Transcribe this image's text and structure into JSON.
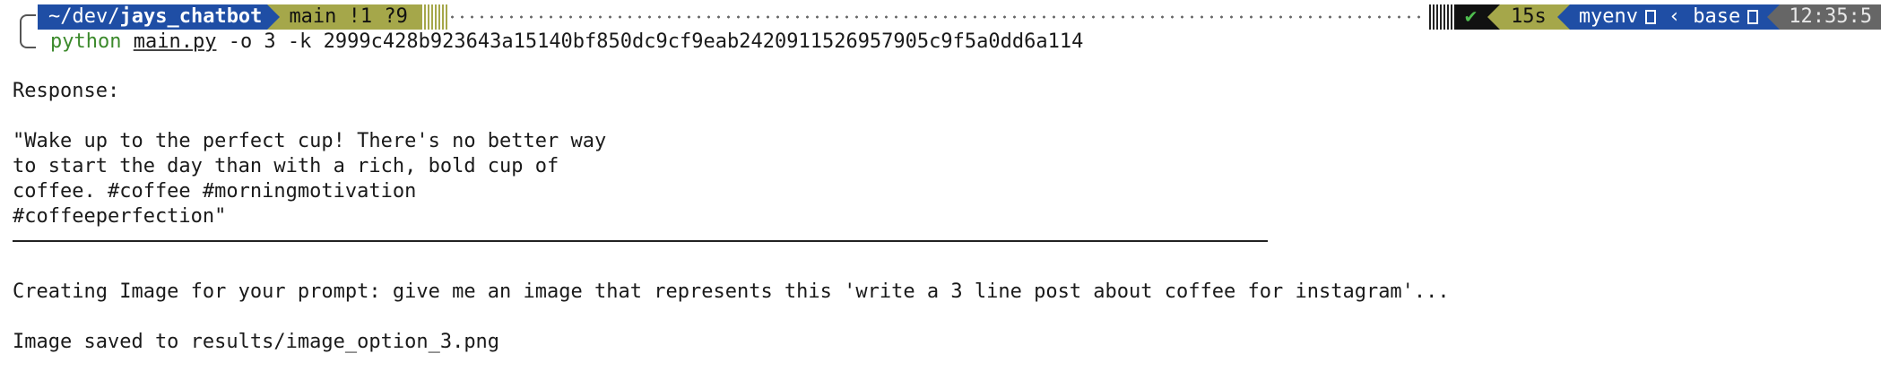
{
  "prompt": {
    "path_prefix": "~/dev/",
    "path_dir": "jays_chatbot",
    "git_branch": "main !1 ?9",
    "status_ok": "✔",
    "duration": "15s",
    "env1": "myenv",
    "env2": "base",
    "clock": "12:35:5",
    "colors": {
      "dir_bg": "#1f4ea5",
      "git_bg": "#a5a74a",
      "ok_fg": "#4fbf4f",
      "clock_bg": "#666666"
    }
  },
  "command": {
    "program": "python",
    "file": "main.py",
    "args": " -o 3 -k 2999c428b923643a15140bf850dc9cf9eab2420911526957905c9f5a0dd6a114"
  },
  "output": {
    "response_label": "Response:",
    "response_lines": [
      "\"Wake up to the perfect cup! There's no better way",
      "to start the day than with a rich, bold cup of",
      "coffee. #coffee #morningmotivation",
      "#coffeeperfection\""
    ],
    "creating_line": "Creating Image for your prompt: give me an image that represents this 'write a 3 line post about coffee for instagram'...",
    "saved_line": "Image saved to results/image_option_3.png"
  }
}
